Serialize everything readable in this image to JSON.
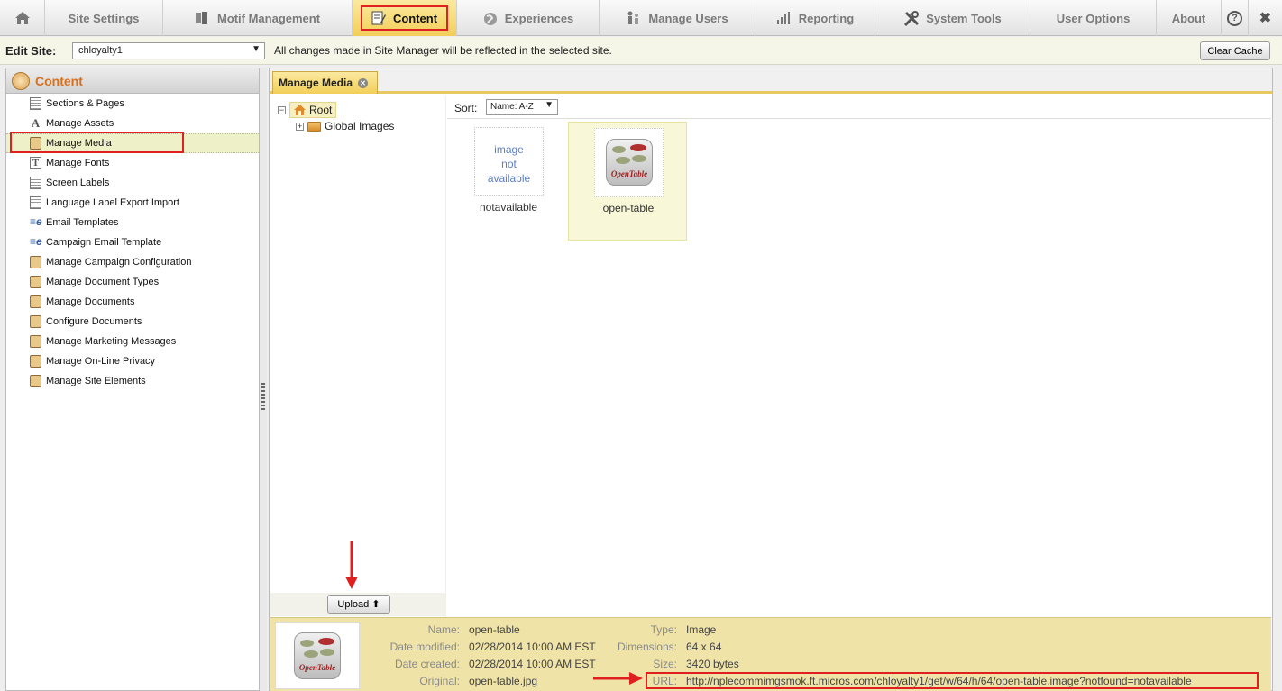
{
  "nav": {
    "items": [
      {
        "label": "",
        "icon": "home-icon"
      },
      {
        "label": "Site Settings",
        "icon": ""
      },
      {
        "label": "Motif Management",
        "icon": "motif-icon"
      },
      {
        "label": "Content",
        "icon": "content-icon"
      },
      {
        "label": "Experiences",
        "icon": "globe-icon"
      },
      {
        "label": "Manage Users",
        "icon": "users-icon"
      },
      {
        "label": "Reporting",
        "icon": "bar-chart-icon"
      },
      {
        "label": "System Tools",
        "icon": "tools-icon"
      },
      {
        "label": "User Options",
        "icon": ""
      },
      {
        "label": "About",
        "icon": ""
      }
    ],
    "help_icon": "?",
    "close_icon": "✖"
  },
  "sitebar": {
    "label": "Edit Site:",
    "selected_site": "chloyalty1",
    "message": "All changes made in Site Manager will be reflected in the selected site.",
    "clear_cache": "Clear Cache"
  },
  "left": {
    "title": "Content",
    "items": [
      {
        "label": "Sections & Pages",
        "icon": "page-icon"
      },
      {
        "label": "Manage Assets",
        "icon": "font-a-icon"
      },
      {
        "label": "Manage Media",
        "icon": "media-icon"
      },
      {
        "label": "Manage Fonts",
        "icon": "font-t-icon"
      },
      {
        "label": "Screen Labels",
        "icon": "page-icon"
      },
      {
        "label": "Language Label Export Import",
        "icon": "page-icon"
      },
      {
        "label": "Email Templates",
        "icon": "email-icon"
      },
      {
        "label": "Campaign Email Template",
        "icon": "email-icon"
      },
      {
        "label": "Manage Campaign Configuration",
        "icon": "doc-icon"
      },
      {
        "label": "Manage Document Types",
        "icon": "doc-icon"
      },
      {
        "label": "Manage Documents",
        "icon": "doc-icon"
      },
      {
        "label": "Configure Documents",
        "icon": "doc-icon"
      },
      {
        "label": "Manage Marketing Messages",
        "icon": "doc-icon"
      },
      {
        "label": "Manage On-Line Privacy",
        "icon": "doc-icon"
      },
      {
        "label": "Manage Site Elements",
        "icon": "doc-icon"
      }
    ]
  },
  "tab": {
    "label": "Manage Media"
  },
  "tree": {
    "root": "Root",
    "child": "Global Images"
  },
  "sort": {
    "label": "Sort:",
    "value": "Name: A-Z"
  },
  "media": {
    "items": [
      {
        "name": "notavailable",
        "placeholder": [
          "image",
          "not",
          "available"
        ]
      },
      {
        "name": "open-table",
        "logo_text": "OpenTable"
      }
    ]
  },
  "upload": {
    "label": "Upload ⬆"
  },
  "details": {
    "name_label": "Name:",
    "name": "open-table",
    "modified_label": "Date modified:",
    "modified": "02/28/2014 10:00 AM EST",
    "created_label": "Date created:",
    "created": "02/28/2014 10:00 AM EST",
    "original_label": "Original:",
    "original": "open-table.jpg",
    "type_label": "Type:",
    "type": "Image",
    "dimensions_label": "Dimensions:",
    "dimensions": "64 x 64",
    "size_label": "Size:",
    "size": "3420 bytes",
    "url_label": "URL:",
    "url": "http://nplecommimgsmok.ft.micros.com/chloyalty1/get/w/64/h/64/open-table.image?notfound=notavailable"
  },
  "colors": {
    "accent": "#f2cf58",
    "highlight": "#e02020",
    "heading": "#d9701c"
  }
}
